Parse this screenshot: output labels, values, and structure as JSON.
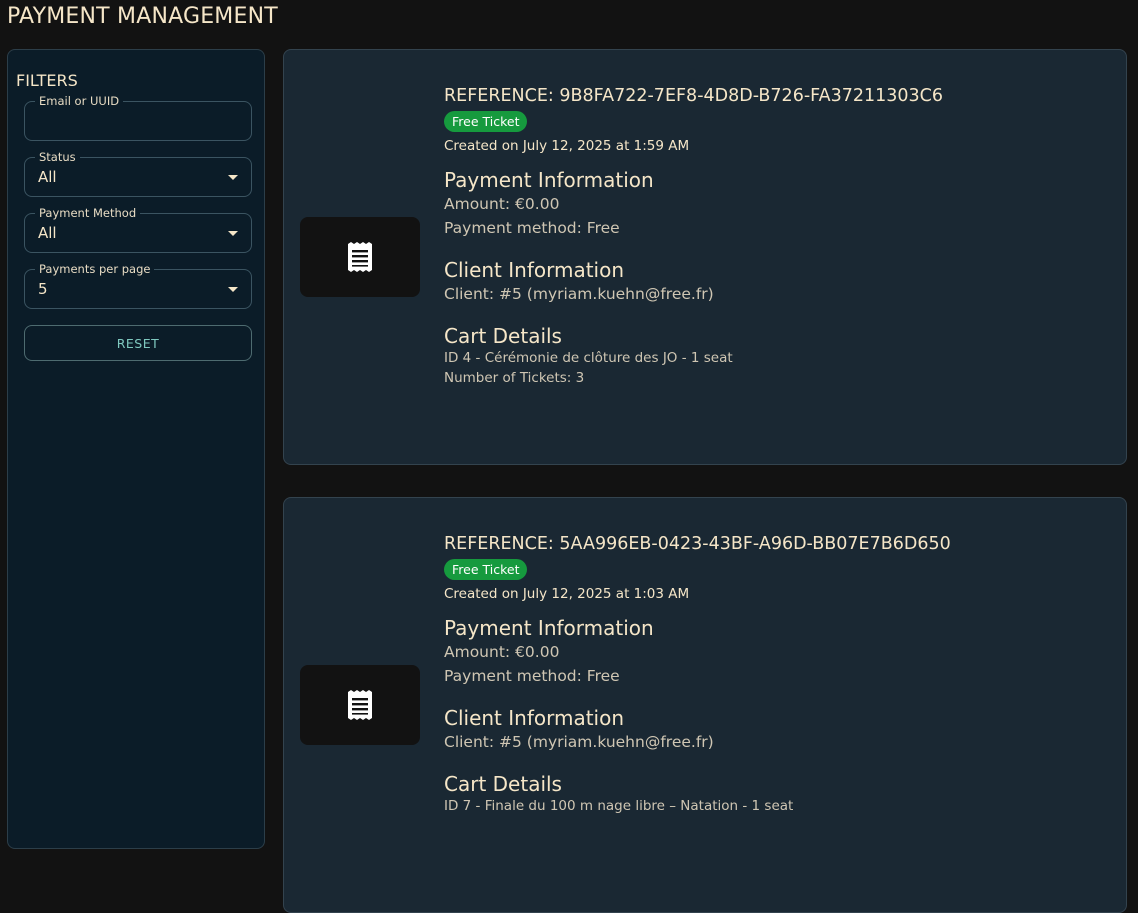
{
  "page": {
    "title": "PAYMENT MANAGEMENT"
  },
  "filters": {
    "title": "FILTERS",
    "email_label": "Email or UUID",
    "email_value": "",
    "status_label": "Status",
    "status_value": "All",
    "method_label": "Payment Method",
    "method_value": "All",
    "per_page_label": "Payments per page",
    "per_page_value": "5",
    "reset_label": "RESET"
  },
  "payments": [
    {
      "reference": "REFERENCE: 9B8FA722-7EF8-4D8D-B726-FA37211303C6",
      "badge": "Free Ticket",
      "created": "Created on July 12, 2025 at 1:59 AM",
      "payment_title": "Payment Information",
      "amount": "Amount: €0.00",
      "method": "Payment method: Free",
      "client_title": "Client Information",
      "client": "Client: #5 (myriam.kuehn@free.fr)",
      "cart_title": "Cart Details",
      "cart_line": "ID 4 - Cérémonie de clôture des JO - 1 seat",
      "tickets": "Number of Tickets: 3"
    },
    {
      "reference": "REFERENCE: 5AA996EB-0423-43BF-A96D-BB07E7B6D650",
      "badge": "Free Ticket",
      "created": "Created on July 12, 2025 at 1:03 AM",
      "payment_title": "Payment Information",
      "amount": "Amount: €0.00",
      "method": "Payment method: Free",
      "client_title": "Client Information",
      "client": "Client: #5 (myriam.kuehn@free.fr)",
      "cart_title": "Cart Details",
      "cart_line": "ID 7 - Finale du 100 m nage libre – Natation - 1 seat"
    }
  ],
  "colors": {
    "badge_green": "#169a3e",
    "accent_text": "#f5e6c8",
    "reset_text": "#7fc9c0"
  },
  "icons": {
    "receipt": "receipt-icon"
  }
}
